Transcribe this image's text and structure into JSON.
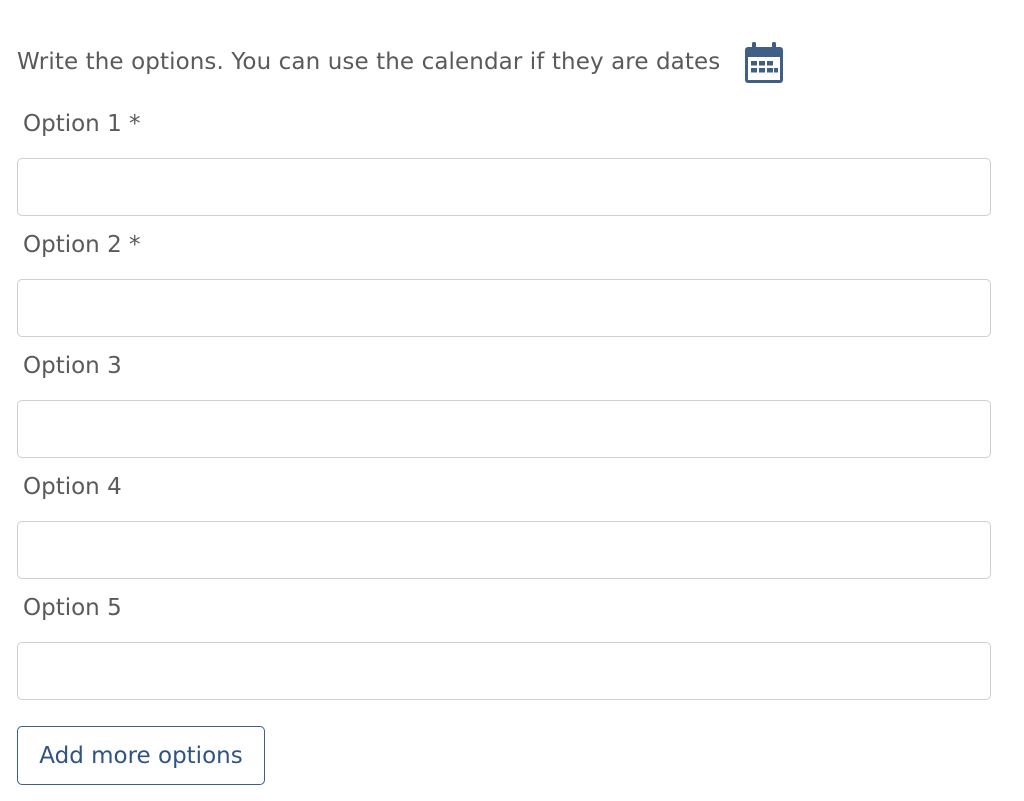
{
  "instructions": {
    "text": "Write the options. You can use the calendar if they are dates",
    "calendar_icon": "calendar-icon"
  },
  "colors": {
    "label_text": "#5a5a5a",
    "input_border": "#cfcfcf",
    "accent": "#3f5f86"
  },
  "options": [
    {
      "label": "Option 1 *",
      "value": "",
      "placeholder": ""
    },
    {
      "label": "Option 2 *",
      "value": "",
      "placeholder": ""
    },
    {
      "label": "Option 3",
      "value": "",
      "placeholder": ""
    },
    {
      "label": "Option 4",
      "value": "",
      "placeholder": ""
    },
    {
      "label": "Option 5",
      "value": "",
      "placeholder": ""
    }
  ],
  "add_button": {
    "label": "Add more options"
  }
}
